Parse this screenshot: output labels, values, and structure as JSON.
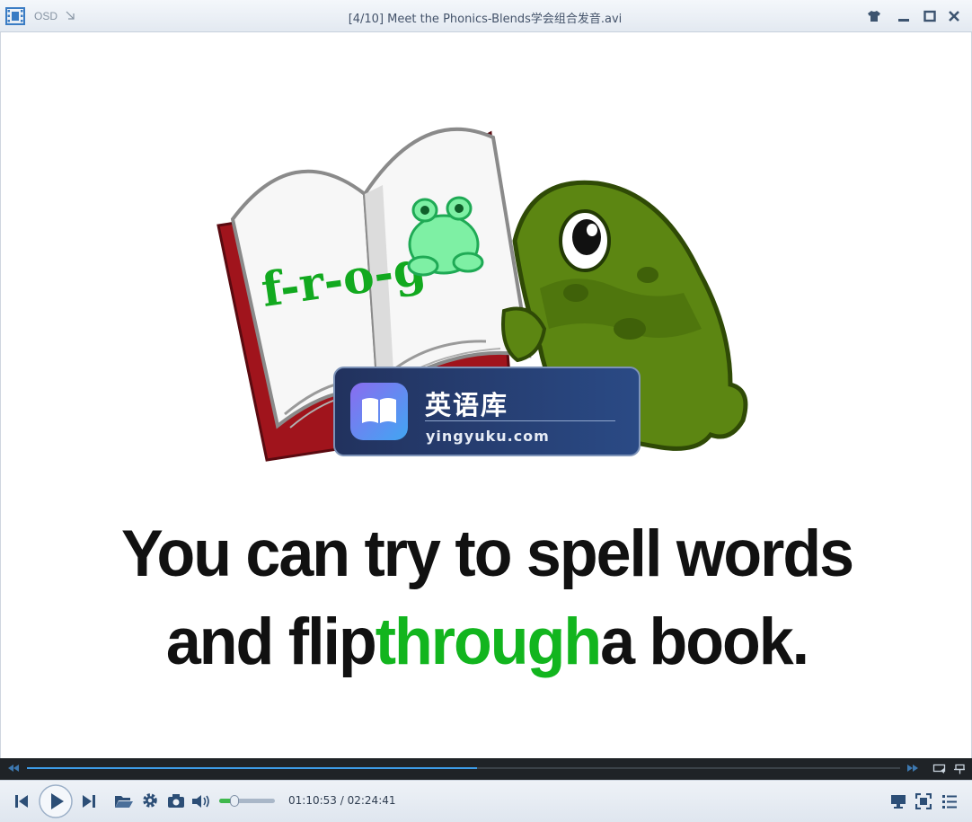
{
  "titlebar": {
    "osd_label": "OSD",
    "title": "[4/10] Meet the Phonics-Blends学会组合发音.avi",
    "icons": [
      "film-strip-icon",
      "pin-arrow-icon",
      "skin-shirt-icon",
      "minimize-icon",
      "maximize-icon",
      "close-icon"
    ]
  },
  "video": {
    "book_word": "f-r-o-g",
    "watermark": {
      "title": "英语库",
      "url": "yingyuku.com"
    },
    "subtitle": {
      "line1": "You can try to spell words",
      "line2_pre": "and flip",
      "line2_highlight": "through",
      "line2_post": "a book."
    },
    "highlight_color": "#12b51e"
  },
  "playback": {
    "progress": 0.515,
    "volume": 0.28,
    "current_time": "01:10:53",
    "separator": "/",
    "total_time": "02:24:41"
  },
  "colors": {
    "accent": "#3d9be6",
    "volume": "#3fb84d"
  }
}
